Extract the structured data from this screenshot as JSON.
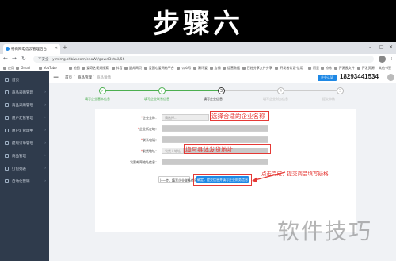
{
  "banner": {
    "title": "步骤六"
  },
  "browser": {
    "tab_title": "畅商网电信云管理后台",
    "omnibox_secure": "不安全",
    "url": "yimimg.shbiw.com/shoWr/gowdDetail/56",
    "bookmarks": [
      "应用",
      "Gmail",
      "YouTube",
      "地图",
      "爱奇艺视频搜索",
      "抖音",
      "盟邦网页",
      "爱国心爱网络平台",
      "公众号",
      "腾讯爱",
      "店铺",
      "运营数据",
      "百姓分享文件分享",
      "开发者认证·信用",
      "阿里",
      "京东",
      "开源云文件",
      "开发资源"
    ],
    "bookmarks_other": "其他书签"
  },
  "sidebar": {
    "items": [
      {
        "label": "首页"
      },
      {
        "label": "商品采购管理"
      },
      {
        "label": "商品采购管理"
      },
      {
        "label": "用户汇管管理"
      },
      {
        "label": "用户汇管理中"
      },
      {
        "label": "提现订单管理"
      },
      {
        "label": "商品管理"
      },
      {
        "label": "打包列表"
      },
      {
        "label": "自动化营销"
      }
    ]
  },
  "topbar": {
    "crumbs": [
      "首页",
      "/",
      "商品管理",
      "/",
      "商品详情"
    ],
    "cert_button": "企业认证",
    "phone": "18293441534"
  },
  "steps": [
    {
      "label": "填写企业基本信息",
      "state": "done",
      "num": "✓"
    },
    {
      "label": "填写企业联系信息",
      "state": "done",
      "num": "✓"
    },
    {
      "label": "填写企业信息",
      "state": "current",
      "num": "3"
    },
    {
      "label": "填写企业财务信息",
      "state": "todo",
      "num": "4"
    },
    {
      "label": "提交审核",
      "state": "todo",
      "num": "5"
    }
  ],
  "form": {
    "rows": [
      {
        "label": "企业全称：",
        "required": true,
        "value": "请选择..."
      },
      {
        "label": "企业所在地：",
        "required": true,
        "value": ""
      },
      {
        "label": "联系电话：",
        "required": true,
        "value": ""
      },
      {
        "label": "发货地址：",
        "required": true,
        "value": "发货人地址..."
      },
      {
        "label": "发票邮寄地址信息：",
        "required": false,
        "value": ""
      }
    ],
    "annotation_1": "选择合适的企业名称",
    "annotation_2": "填写具体发货地址",
    "prev_button": "上一步，填写企业联系信息",
    "next_button": "确定，提交信息并填写企业财务信息"
  },
  "hint": "点击完成，提交商品填写疑格",
  "watermark": "软件技巧"
}
